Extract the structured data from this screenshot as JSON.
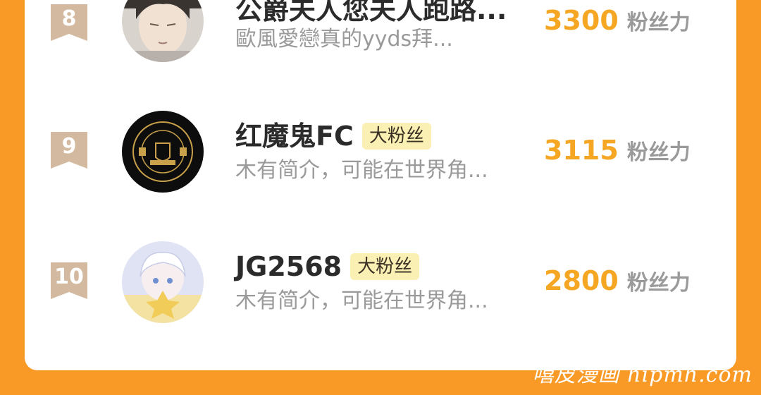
{
  "leaderboard": {
    "rows": [
      {
        "rank": "8",
        "name": "公爵夫人您夫人跑路...",
        "badge": "",
        "intro": "歐風愛戀真的yyds拜...",
        "score": "3300",
        "score_unit": "粉丝力"
      },
      {
        "rank": "9",
        "name": "红魔鬼FC",
        "badge": "大粉丝",
        "intro": "木有简介，可能在世界角...",
        "score": "3115",
        "score_unit": "粉丝力"
      },
      {
        "rank": "10",
        "name": "JG2568",
        "badge": "大粉丝",
        "intro": "木有简介，可能在世界角...",
        "score": "2800",
        "score_unit": "粉丝力"
      }
    ]
  },
  "watermark": "嘻皮漫画 hipmh.com",
  "colors": {
    "page_background": "#f99a26",
    "score": "#f5a623",
    "rank_ribbon": "#d3b99f",
    "badge_background": "#fbf0b4"
  },
  "icons": {
    "rank_marker": "bookmark-ribbon-icon"
  }
}
